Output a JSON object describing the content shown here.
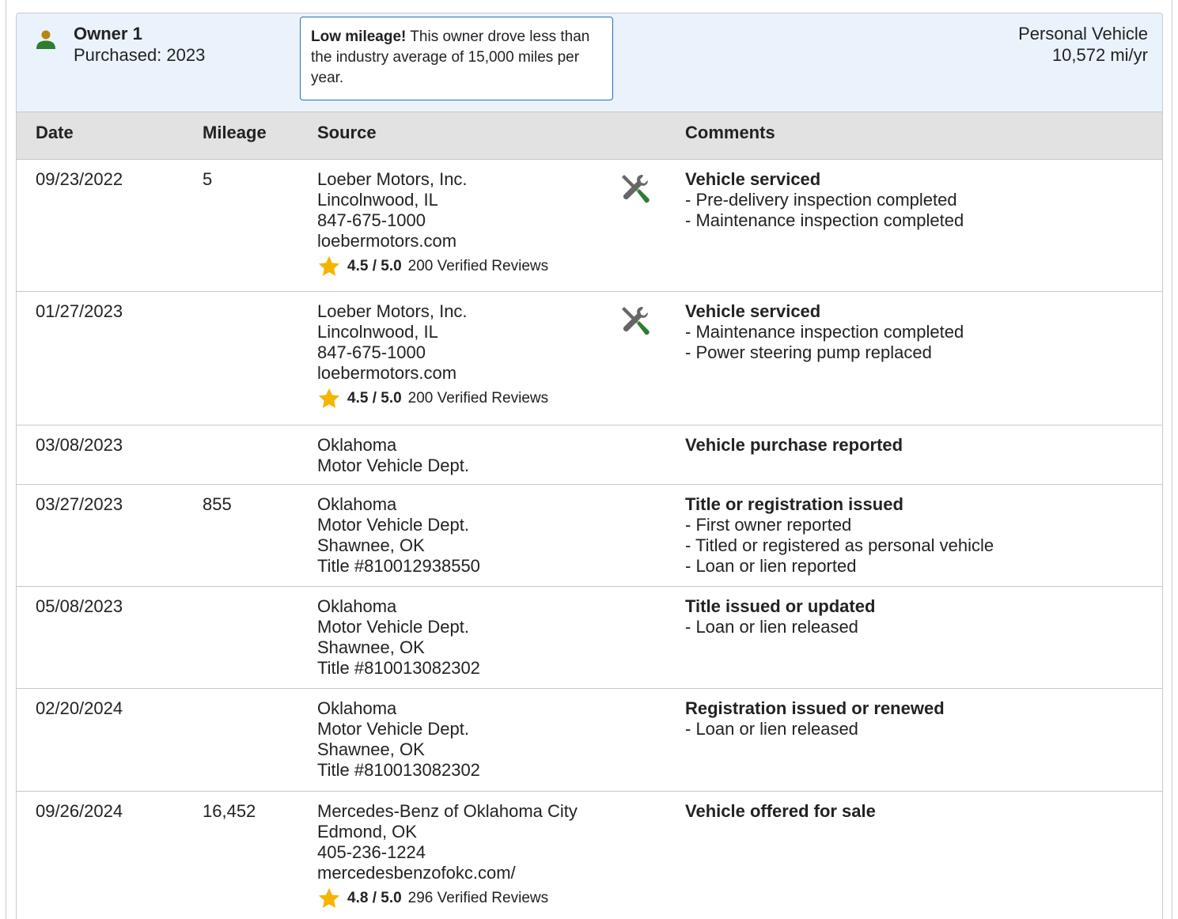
{
  "owner": {
    "name": "Owner 1",
    "purchased": "Purchased: 2023",
    "note_bold": "Low mileage!",
    "note_text": " This owner drove less than the industry average of 15,000 miles per year.",
    "vehicle_type": "Personal Vehicle",
    "mileage_rate": "10,572 mi/yr",
    "icon": "person-icon",
    "icon_color": "#2e7d32",
    "head_color": "#b8860b"
  },
  "columns": {
    "date": "Date",
    "mileage": "Mileage",
    "source": "Source",
    "comments": "Comments"
  },
  "records": [
    {
      "date": "09/23/2022",
      "mileage": "5",
      "source": [
        "Loeber Motors, Inc.",
        "Lincolnwood, IL",
        "847-675-1000",
        "loebermotors.com"
      ],
      "rating": {
        "score": "4.5 / 5.0",
        "reviews": "200 Verified Reviews"
      },
      "service_icon": true,
      "comment_title": "Vehicle serviced",
      "comment_items": [
        "- Pre-delivery inspection completed",
        "- Maintenance inspection completed"
      ]
    },
    {
      "date": "01/27/2023",
      "mileage": "",
      "source": [
        "Loeber Motors, Inc.",
        "Lincolnwood, IL",
        "847-675-1000",
        "loebermotors.com"
      ],
      "rating": {
        "score": "4.5 / 5.0",
        "reviews": "200 Verified Reviews"
      },
      "service_icon": true,
      "comment_title": "Vehicle serviced",
      "comment_items": [
        "- Maintenance inspection completed",
        "- Power steering pump replaced"
      ]
    },
    {
      "date": "03/08/2023",
      "mileage": "",
      "source": [
        "Oklahoma",
        "Motor Vehicle Dept."
      ],
      "rating": null,
      "service_icon": false,
      "comment_title": "Vehicle purchase reported",
      "comment_items": []
    },
    {
      "date": "03/27/2023",
      "mileage": "855",
      "source": [
        "Oklahoma",
        "Motor Vehicle Dept.",
        "Shawnee, OK",
        "Title #810012938550"
      ],
      "rating": null,
      "service_icon": false,
      "comment_title": "Title or registration issued",
      "comment_items": [
        "- First owner reported",
        "- Titled or registered as personal vehicle",
        "- Loan or lien reported"
      ]
    },
    {
      "date": "05/08/2023",
      "mileage": "",
      "source": [
        "Oklahoma",
        "Motor Vehicle Dept.",
        "Shawnee, OK",
        "Title #810013082302"
      ],
      "rating": null,
      "service_icon": false,
      "comment_title": "Title issued or updated",
      "comment_items": [
        "- Loan or lien released"
      ]
    },
    {
      "date": "02/20/2024",
      "mileage": "",
      "source": [
        "Oklahoma",
        "Motor Vehicle Dept.",
        "Shawnee, OK",
        "Title #810013082302"
      ],
      "rating": null,
      "service_icon": false,
      "comment_title": "Registration issued or renewed",
      "comment_items": [
        "- Loan or lien released"
      ]
    },
    {
      "date": "09/26/2024",
      "mileage": "16,452",
      "source": [
        "Mercedes-Benz of Oklahoma City",
        "Edmond, OK",
        "405-236-1224",
        "mercedesbenzofokc.com/"
      ],
      "rating": {
        "score": "4.8 / 5.0",
        "reviews": "296 Verified Reviews"
      },
      "service_icon": false,
      "comment_title": "Vehicle offered for sale",
      "comment_items": []
    }
  ],
  "colors": {
    "header_bg": "#eaf3fb",
    "table_head_bg": "#e2e2e2",
    "note_border": "#2a6fb8",
    "star": "#f5b400",
    "tool_grey": "#666666",
    "tool_green": "#2e7d32"
  }
}
